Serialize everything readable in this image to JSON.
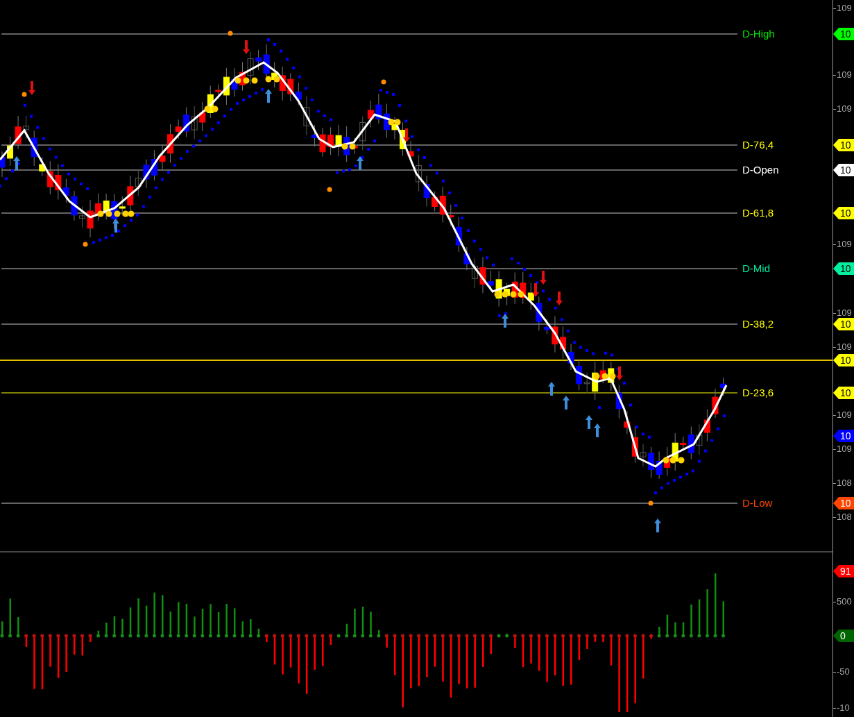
{
  "price_panel": {
    "levels": [
      {
        "label": "D-High",
        "color": "#00e600"
      },
      {
        "label": "D-76,4",
        "color": "#ffff00"
      },
      {
        "label": "D-Open",
        "color": "#ffffff"
      },
      {
        "label": "D-61,8",
        "color": "#ffff00"
      },
      {
        "label": "D-Mid",
        "color": "#00e8a0"
      },
      {
        "label": "D-38,2",
        "color": "#ffff00"
      },
      {
        "label": "D-23,6",
        "color": "#ffff00"
      },
      {
        "label": "D-Low",
        "color": "#ff4500"
      }
    ],
    "price_tags": [
      {
        "text": "10",
        "color": "#00ff00"
      },
      {
        "text": "10",
        "color": "#ffff00"
      },
      {
        "text": "10",
        "color": "#ffffff"
      },
      {
        "text": "10",
        "color": "#ffff00"
      },
      {
        "text": "10",
        "color": "#00f0a0"
      },
      {
        "text": "10",
        "color": "#ffff00"
      },
      {
        "text": "10",
        "color": "#ffff00"
      },
      {
        "text": "10",
        "color": "#ffff00"
      },
      {
        "text": "10",
        "color": "#0000ff"
      },
      {
        "text": "10",
        "color": "#ff4500"
      }
    ],
    "axis_ticks": [
      "109",
      "109",
      "109",
      "109",
      "109",
      "109",
      "109",
      "109",
      "108",
      "108"
    ]
  },
  "oscillator_panel": {
    "tags": [
      {
        "text": "91",
        "color": "#ff0000"
      },
      {
        "text": "0",
        "color": "#006400"
      }
    ],
    "axis_ticks": [
      "500",
      "-50",
      "-10"
    ]
  }
}
